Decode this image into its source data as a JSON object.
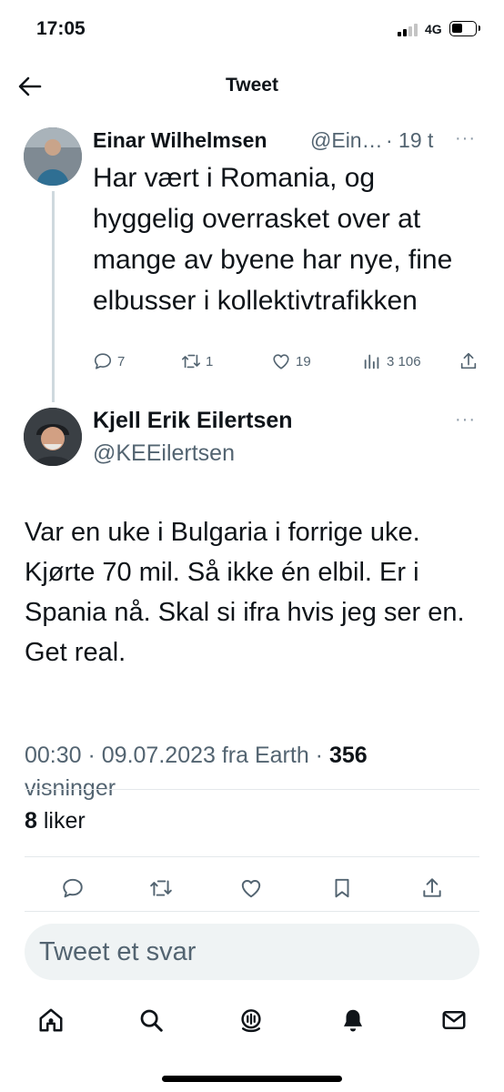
{
  "status_bar": {
    "time": "17:05",
    "network": "4G"
  },
  "header": {
    "title": "Tweet"
  },
  "parent_tweet": {
    "author_name": "Einar Wilhelmsen",
    "handle": "@Ein…",
    "time": "· 19 t",
    "text": "Har vært i Romania, og hyggelig overrasket over at mange av byene har nye, fine elbusser i kollektivtrafikken",
    "replies": "7",
    "retweets": "1",
    "likes": "19",
    "views": "3 106"
  },
  "reply_tweet": {
    "author_name": "Kjell Erik Eilertsen",
    "handle": "@KEEilertsen",
    "text": "Var en uke i Bulgaria i forrige uke. Kjørte 70 mil. Så ikke én elbil. Er i Spania nå. Skal si ifra hvis jeg ser en.\nGet real.",
    "timestamp": "00:30 · 09.07.2023 fra Earth · ",
    "view_count": "356",
    "views_label": "visninger",
    "like_count": "8",
    "likes_label": "liker"
  },
  "reply_input": {
    "placeholder": "Tweet et svar"
  },
  "more_menu": "···",
  "colors": {
    "text": "#0f1419",
    "secondary": "#536471",
    "divider": "#e4e8eb",
    "input_bg": "#eff3f4"
  },
  "icons": [
    "back-arrow-icon",
    "reply-icon",
    "retweet-icon",
    "like-icon",
    "views-icon",
    "share-icon",
    "bookmark-icon",
    "home-icon",
    "search-icon",
    "spaces-icon",
    "notifications-icon",
    "messages-icon"
  ]
}
